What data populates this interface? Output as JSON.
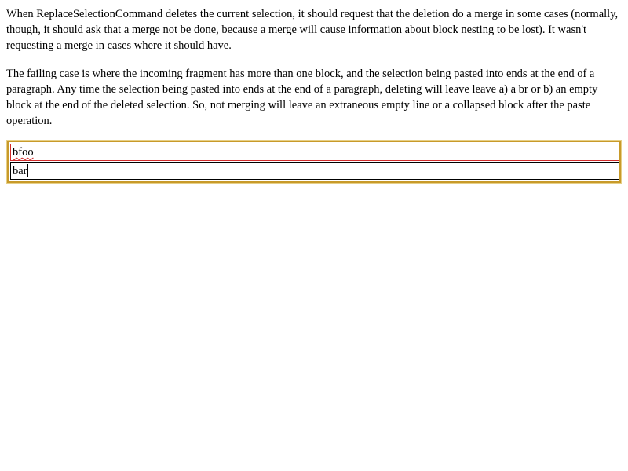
{
  "document": {
    "paragraphs": [
      "When ReplaceSelectionCommand deletes the current selection, it should request that the deletion do a merge in some cases (normally, though, it should ask that a merge not be done, because a merge will cause information about block nesting to be lost). It wasn't requesting a merge in cases where it should have.",
      "The failing case is where the incoming fragment has more than one block, and the selection being pasted into ends at the end of a paragraph. Any time the selection being pasted into ends at the end of a paragraph, deleting will leave leave a) a br or b) an empty block at the end of the deleted selection. So, not merging will leave an extraneous empty line or a collapsed block after the paste operation."
    ]
  },
  "editor": {
    "blocks": [
      {
        "text": "bfoo",
        "misspelled": true
      },
      {
        "text": "bar",
        "has_caret": true
      }
    ],
    "border_color": "#c89a2a",
    "first_block_border_color": "#d22a2a",
    "spellcheck_underline_color": "#d22a2a"
  }
}
